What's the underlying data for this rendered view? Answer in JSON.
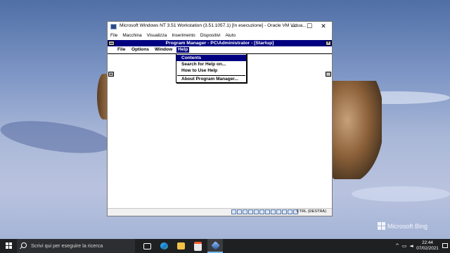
{
  "desktop": {
    "watermark_label": "Microsoft Bing"
  },
  "vm_window": {
    "title": "Microsoft Windows NT 3.51 Workstation (3.51.1057.1) [In esecuzione] - Oracle VM Virtua...",
    "controls": {
      "minimize": "—",
      "maximize": "☐",
      "close": "✕"
    },
    "menu": [
      "File",
      "Macchina",
      "Visualizza",
      "Inserimento",
      "Dispositivi",
      "Aiuto"
    ],
    "status_host_key": "CTRL (DESTRA)"
  },
  "program_manager": {
    "title": "Program Manager - PC\\Administrator - [Startup]",
    "menu": [
      "File",
      "Options",
      "Window",
      "Help"
    ],
    "active_menu": "Help",
    "help_items": [
      "Contents",
      "Search for Help on...",
      "How to Use Help",
      "About Program Manager..."
    ],
    "selected_help_item": "Contents"
  },
  "taskbar": {
    "search_placeholder": "Scrivi qui per eseguire la ricerca",
    "time": "22:44",
    "date": "07/02/2021",
    "apps": [
      "task-view",
      "edge",
      "file-explorer",
      "store",
      "virtualbox"
    ]
  },
  "colors": {
    "pm_titlebar": "#000080",
    "taskbar": "#1f2022"
  }
}
